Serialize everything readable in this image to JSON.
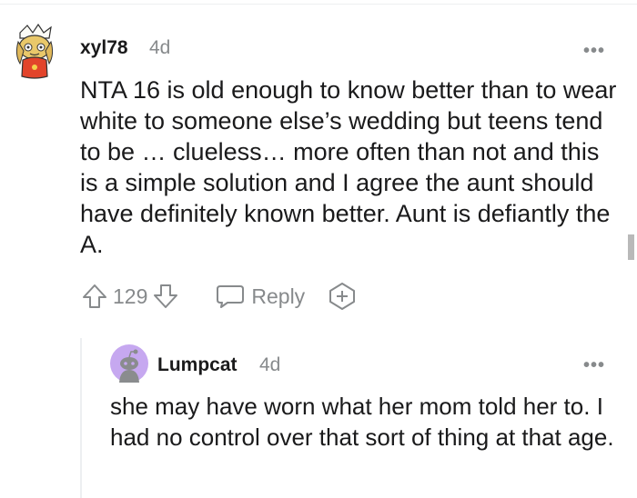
{
  "comment": {
    "author": "xyl78",
    "age": "4d",
    "more_label": "•••",
    "body": "NTA 16 is old enough to know better than to wear white to someone else’s wedding but teens tend to be … clueless… more often than not and this is a simple solution and I agree the aunt should have definitely known better. Aunt is defiantly the A.",
    "score": "129",
    "reply_label": "Reply"
  },
  "reply": {
    "author": "Lumpcat",
    "age": "4d",
    "more_label": "•••",
    "body": "she may have worn what her mom told her to. I had no control over that sort of thing at that age."
  },
  "colors": {
    "text": "#1a1a1b",
    "meta": "#878a8c",
    "reply_avatar_bg": "#c6a8f0"
  },
  "icons": {
    "upvote": "arrow-up-outline",
    "downvote": "arrow-down-outline",
    "reply": "speech-bubble-outline",
    "award": "award-plus-outline",
    "more": "horizontal-ellipsis"
  }
}
